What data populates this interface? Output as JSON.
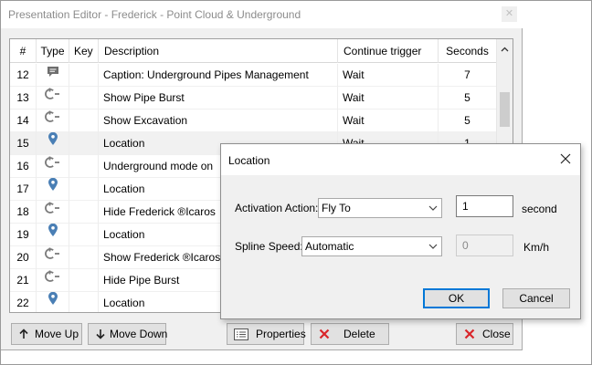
{
  "window": {
    "title": "Presentation Editor - Frederick - Point Cloud & Underground",
    "close_glyph": "✕"
  },
  "table": {
    "columns": {
      "num": "#",
      "type": "Type",
      "key": "Key",
      "description": "Description",
      "trigger": "Continue trigger",
      "seconds": "Seconds"
    },
    "rows": [
      {
        "num": "12",
        "type": "caption",
        "key": "",
        "description": "Caption: Underground Pipes Management",
        "trigger": "Wait",
        "seconds": "7"
      },
      {
        "num": "13",
        "type": "action",
        "key": "",
        "description": "Show Pipe Burst",
        "trigger": "Wait",
        "seconds": "5"
      },
      {
        "num": "14",
        "type": "action",
        "key": "",
        "description": "Show Excavation",
        "trigger": "Wait",
        "seconds": "5"
      },
      {
        "num": "15",
        "type": "location",
        "key": "",
        "description": "Location",
        "trigger": "Wait",
        "seconds": "1"
      },
      {
        "num": "16",
        "type": "action",
        "key": "",
        "description": "Underground mode on",
        "trigger": "",
        "seconds": ""
      },
      {
        "num": "17",
        "type": "location",
        "key": "",
        "description": "Location",
        "trigger": "",
        "seconds": ""
      },
      {
        "num": "18",
        "type": "action",
        "key": "",
        "description": "Hide Frederick ®Icaros",
        "trigger": "",
        "seconds": ""
      },
      {
        "num": "19",
        "type": "location",
        "key": "",
        "description": "Location",
        "trigger": "",
        "seconds": ""
      },
      {
        "num": "20",
        "type": "action",
        "key": "",
        "description": "Show Frederick ®Icaros",
        "trigger": "",
        "seconds": ""
      },
      {
        "num": "21",
        "type": "action",
        "key": "",
        "description": "Hide Pipe Burst",
        "trigger": "",
        "seconds": ""
      },
      {
        "num": "22",
        "type": "location",
        "key": "",
        "description": "Location",
        "trigger": "",
        "seconds": ""
      }
    ],
    "selected_row": "15"
  },
  "buttons": {
    "move_up": "Move Up",
    "move_down": "Move Down",
    "properties": "Properties",
    "delete": "Delete",
    "close": "Close"
  },
  "dialog": {
    "title": "Location",
    "activation_label": "Activation Action:",
    "activation_value": "Fly To",
    "duration_value": "1",
    "duration_unit": "second",
    "spline_label": "Spline Speed:",
    "spline_value": "Automatic",
    "speed_value": "0",
    "speed_unit": "Km/h",
    "ok": "OK",
    "cancel": "Cancel"
  },
  "colors": {
    "location_pin": "#4a7fb5",
    "action_icon": "#7a7a7a",
    "caption_icon": "#6e6e6e",
    "delete_red": "#d9252a",
    "default_button_border": "#0078d7"
  },
  "icons": {
    "caption": "speech-bubble-icon",
    "action": "power-action-icon",
    "location": "map-pin-icon"
  }
}
